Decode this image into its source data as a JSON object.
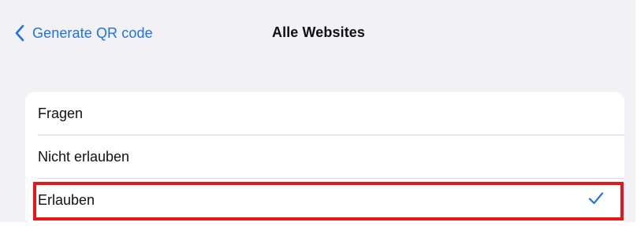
{
  "nav": {
    "back_label": "Generate QR code",
    "title": "Alle Websites"
  },
  "options": [
    {
      "label": "Fragen",
      "selected": false
    },
    {
      "label": "Nicht erlauben",
      "selected": false
    },
    {
      "label": "Erlauben",
      "selected": true
    }
  ],
  "icons": {
    "back": "chevron-left-icon",
    "selected": "checkmark-icon"
  },
  "colors": {
    "accent": "#1f72e0",
    "background": "#f2f1f6",
    "card": "#ffffff",
    "highlight": "#e8161a"
  }
}
